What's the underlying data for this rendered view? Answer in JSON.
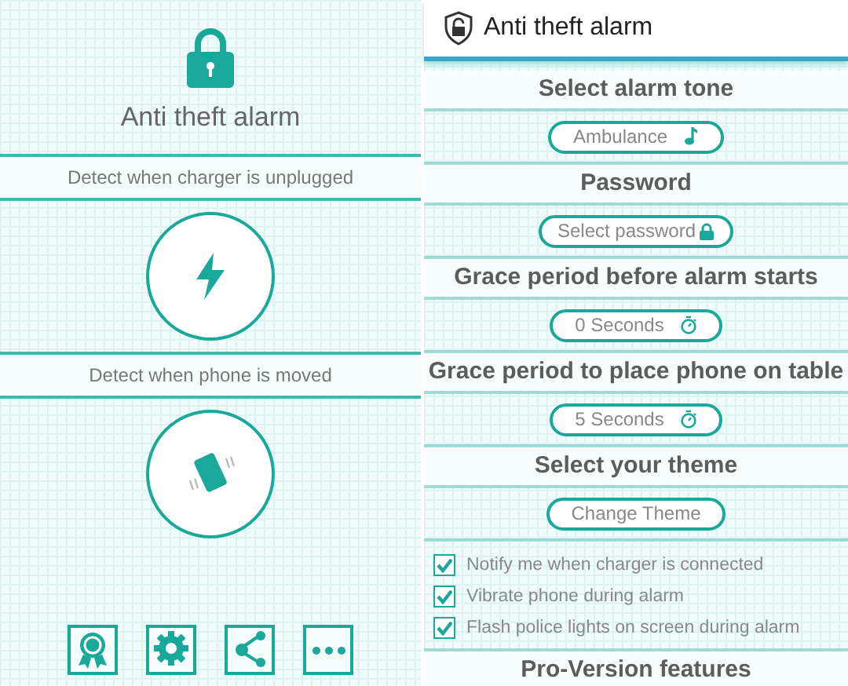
{
  "main_screen": {
    "title": "Anti theft alarm",
    "detectors": [
      {
        "label": "Detect when charger is unplugged",
        "kind": "charger"
      },
      {
        "label": "Detect when phone is moved",
        "kind": "motion"
      }
    ]
  },
  "settings_screen": {
    "title": "Anti theft alarm",
    "sections": [
      {
        "heading": "Select alarm tone",
        "button": "Ambulance",
        "kind": "tone"
      },
      {
        "heading": "Password",
        "button": "Select password",
        "kind": "lock"
      },
      {
        "heading": "Grace period before alarm starts",
        "button": "0 Seconds",
        "kind": "timer"
      },
      {
        "heading": "Grace period to place phone on table",
        "button": "5 Seconds",
        "kind": "timer"
      },
      {
        "heading": "Select your theme",
        "button": "Change Theme",
        "kind": "plain"
      }
    ],
    "options": [
      {
        "label": "Notify me when charger is connected",
        "checked": true
      },
      {
        "label": "Vibrate phone during alarm",
        "checked": true
      },
      {
        "label": "Flash police lights on screen during alarm",
        "checked": true
      }
    ],
    "footer_heading": "Pro-Version features"
  }
}
